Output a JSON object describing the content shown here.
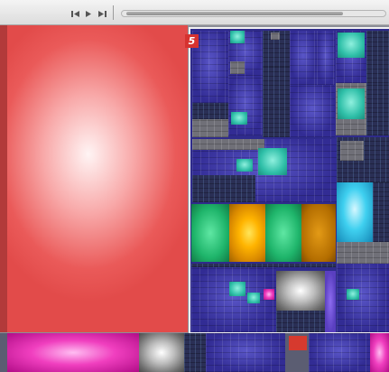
{
  "toolbar": {
    "nav": {
      "back_icon": "step-back-icon",
      "play_icon": "play-icon",
      "forward_icon": "skip-forward-icon"
    },
    "scroll_position": 0.85
  },
  "treemap": {
    "selected_region_badge": "5",
    "colors": {
      "large_red": "#e24b4a",
      "selection_border": "#f2f2f2",
      "badge": "#d6322f",
      "blue": "#3a35a6",
      "teal": "#2fbfa8",
      "cyan": "#3fd0f0",
      "green": "#1fb56b",
      "orange": "#ffb400",
      "magenta": "#f03fbf"
    }
  }
}
